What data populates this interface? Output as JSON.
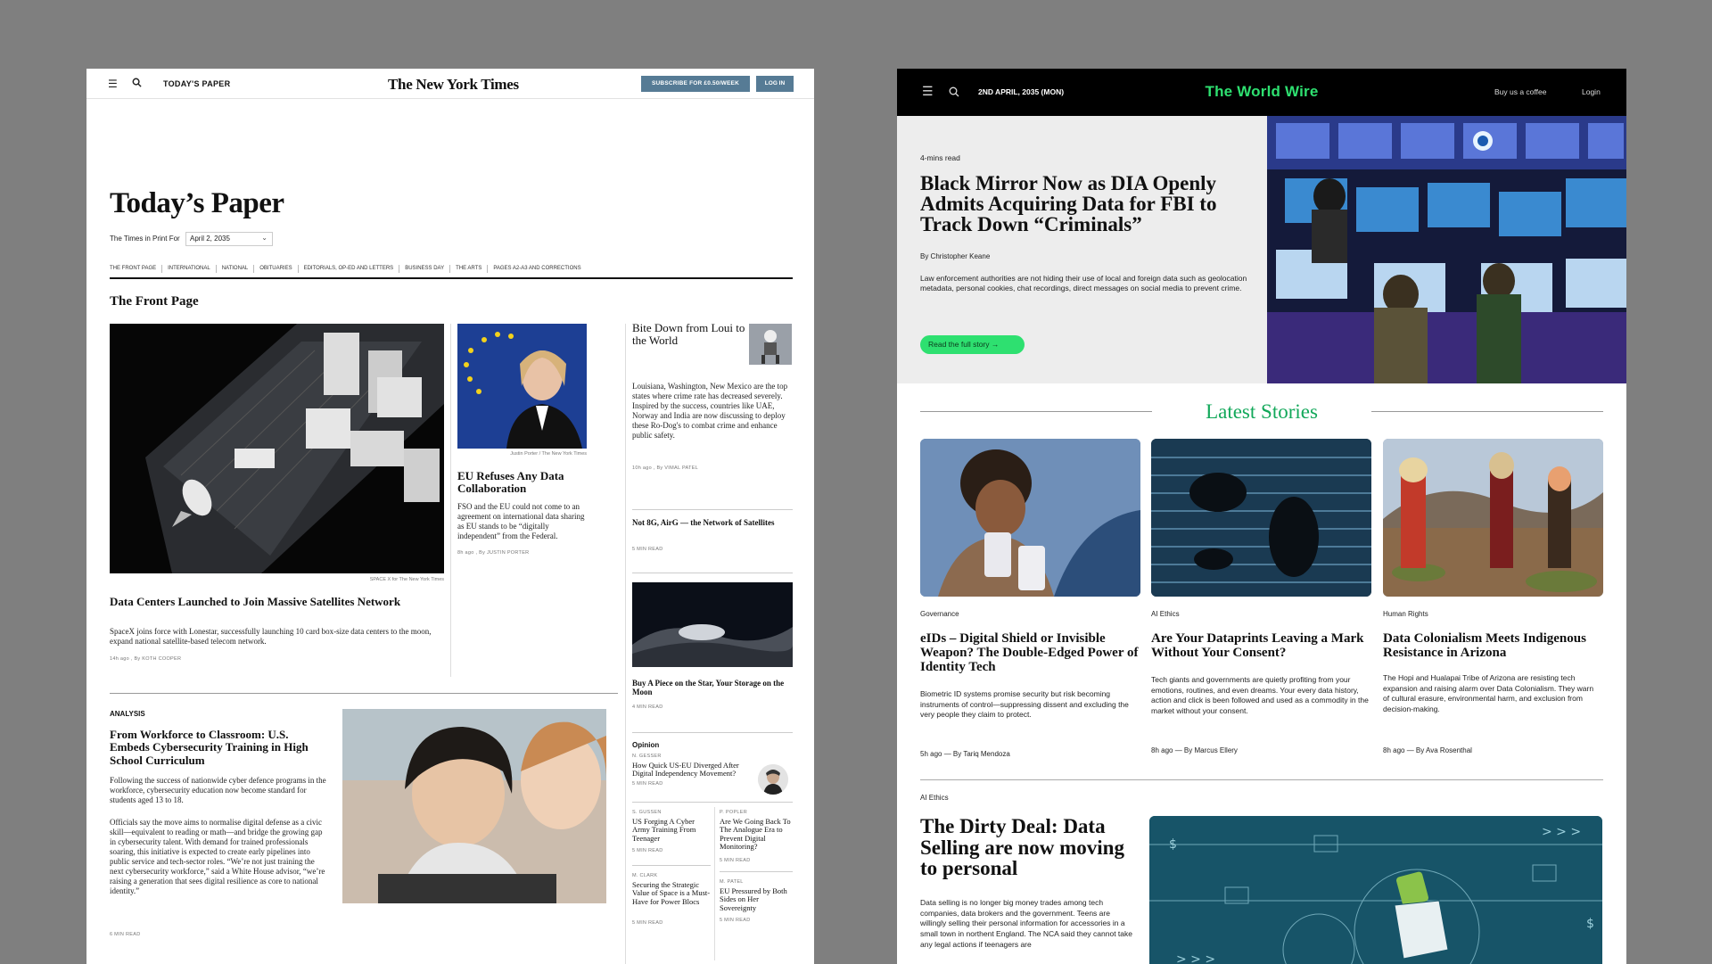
{
  "nyt": {
    "todays_paper_link": "TODAY'S PAPER",
    "logo": "The New York Times",
    "subscribe_label": "SUBSCRIBE FOR £0.50/WEEK",
    "login_label": "LOG IN",
    "page_title": "Today’s Paper",
    "print_for_label": "The Times in Print For",
    "print_date": "April 2, 2035",
    "sections": [
      "THE FRONT PAGE",
      "INTERNATIONAL",
      "NATIONAL",
      "OBITUARIES",
      "EDITORIALS, OP-ED AND LETTERS",
      "BUSINESS DAY",
      "THE ARTS",
      "PAGES A2-A3 AND CORRECTIONS"
    ],
    "front_page_heading": "The Front Page",
    "lead": {
      "caption": "SPACE X for The New York Times",
      "headline": "Data Centers Launched to Join Massive Satellites Network",
      "summary": "SpaceX joins force with Lonestar, successfully launching 10 card box-size data centers to the moon, expand national satellite-based telecom network.",
      "meta": "14h ago , By KOTH COOPER"
    },
    "eu": {
      "caption": "Justin Porter / The New York Times",
      "headline": "EU Refuses Any Data Collaboration",
      "summary": "FSO and the EU could not come to an agreement on international data sharing as EU stands to be “digitally independent” from the Federal.",
      "meta": "8h ago , By JUSTIN PORTER"
    },
    "bite": {
      "headline": "Bite Down from Loui to the World",
      "summary": "Louisiana, Washington, New Mexico are the top states where crime rate has decreased severely.  Inspired by the success, countries like UAE, Norway and India are now discussing to deploy these Ro-Dog's to combat crime and enhance public safety.",
      "meta": "10h ago , By VIMAL PATEL"
    },
    "not8g": {
      "headline": "Not 8G, AirG — the Network of Satellites",
      "meta": "5 MIN READ"
    },
    "moon": {
      "headline": "Buy A Piece on the Star, Your Storage on the Moon",
      "meta": "4 MIN READ"
    },
    "analysis": {
      "kicker": "ANALYSIS",
      "headline": "From Workforce to Classroom: U.S. Embeds Cybersecurity Training in High School Curriculum",
      "p1": "Following the success of nationwide cyber defence programs in the workforce, cybersecurity education now become standard for students aged 13 to 18.",
      "p2": "Officials say the move aims to normalise digital defense as a civic skill—equivalent to reading or math—and bridge the growing gap in cybersecurity talent. With demand for trained professionals soaring, this initiative is expected to create early pipelines into public service and tech-sector roles. “We’re not just training the next cybersecurity workforce,” said a White House advisor, “we’re raising a generation that sees digital resilience as core to national identity.”",
      "meta": "6 MIN READ"
    },
    "opinion": {
      "label": "Opinion",
      "top": {
        "author": "N. GESSER",
        "headline": "How Quick US-EU Diverged After Digital Independency Movement?",
        "meta": "5 MIN READ"
      },
      "grid": [
        {
          "author": "S. GUSSEN",
          "headline": "US Forging A Cyber Army Training From Teenager",
          "meta": "5 MIN READ"
        },
        {
          "author": "P. POPLER",
          "headline": "Are We Going Back To The Analogue Era to Prevent Digital Monitoring?",
          "meta": "5 MIN READ"
        },
        {
          "author": "M. CLARK",
          "headline": "Securing the Strategic Value of Space is a Must-Have for Power Blocs",
          "meta": "5 MIN READ"
        },
        {
          "author": "M. PATEL",
          "headline": "EU Pressured by Both Sides on Her Sovereignty",
          "meta": "5 MIN READ"
        }
      ]
    }
  },
  "ww": {
    "date": "2ND APRIL, 2035 (MON)",
    "logo": "The World Wire",
    "coffee": "Buy us a coffee",
    "login": "Login",
    "hero": {
      "read_time": "4-mins read",
      "headline": "Black Mirror Now as DIA Openly Admits Acquiring Data for FBI to Track Down “Criminals”",
      "byline": "By Christopher Keane",
      "summary": "Law enforcement authorities are not hiding their use of local and foreign data such as geolocation metadata, personal cookies, chat recordings, direct messages on social media to prevent crime.",
      "cta": "Read the full story"
    },
    "latest_title": "Latest Stories",
    "cards": [
      {
        "category": "Governance",
        "headline": "eIDs – Digital Shield or Invisible Weapon? The Double-Edged Power of Identity Tech",
        "summary": "Biometric ID systems promise security but risk becoming instruments of control—suppressing dissent and excluding the very people they claim to protect.",
        "meta": "5h ago — By Tariq Mendoza"
      },
      {
        "category": "AI Ethics",
        "headline": "Are Your Dataprints Leaving a Mark Without Your Consent?",
        "summary": "Tech giants and governments are quietly profiting from your emotions, routines, and even dreams. Your every data history, action and click is been followed and used as a commodity in the market without your consent.",
        "meta": "8h ago — By Marcus Ellery"
      },
      {
        "category": "Human Rights",
        "headline": "Data Colonialism Meets Indigenous Resistance in Arizona",
        "summary": "The Hopi and Hualapai Tribe of Arizona are resisting tech expansion and raising alarm over Data Colonialism. They warn of cultural erasure, environmental harm, and exclusion from decision-making.",
        "meta": "8h ago — By Ava Rosenthal"
      }
    ],
    "dirty": {
      "category": "AI Ethics",
      "headline": "The Dirty Deal: Data Selling are now moving to personal",
      "summary": "Data selling is no longer big money trades among tech companies, data brokers and the government. Teens are willingly selling their personal information for accessories in a small town in northent England. The NCA said they cannot take any legal actions if teenagers are"
    }
  },
  "colors": {
    "nyt_button": "#567b95",
    "ww_accent": "#2ee070",
    "ww_latest": "#12a85a",
    "ww_header": "#000000",
    "dirty_bg": "#175468"
  }
}
